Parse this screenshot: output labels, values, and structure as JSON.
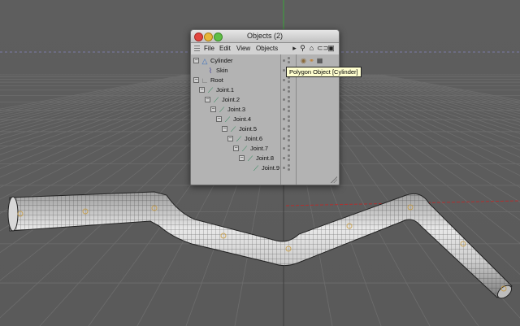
{
  "window": {
    "title": "Objects (2)"
  },
  "menu": {
    "file": "File",
    "edit": "Edit",
    "view": "View",
    "objects": "Objects"
  },
  "toolbar_icons": [
    "play-arrow-icon",
    "search-icon",
    "home-icon",
    "link-icon",
    "new-window-icon"
  ],
  "tree": [
    {
      "label": "Cylinder",
      "icon": "cylinder-icon",
      "depth": 0,
      "expander": "minus"
    },
    {
      "label": "Skin",
      "icon": "skin-icon",
      "depth": 1,
      "expander": "none"
    },
    {
      "label": "Root",
      "icon": "null-icon",
      "depth": 0,
      "expander": "minus"
    },
    {
      "label": "Joint.1",
      "icon": "joint-icon",
      "depth": 1,
      "expander": "minus"
    },
    {
      "label": "Joint.2",
      "icon": "joint-icon",
      "depth": 2,
      "expander": "minus"
    },
    {
      "label": "Joint.3",
      "icon": "joint-icon",
      "depth": 3,
      "expander": "minus"
    },
    {
      "label": "Joint.4",
      "icon": "joint-icon",
      "depth": 4,
      "expander": "minus"
    },
    {
      "label": "Joint.5",
      "icon": "joint-icon",
      "depth": 5,
      "expander": "minus"
    },
    {
      "label": "Joint.6",
      "icon": "joint-icon",
      "depth": 6,
      "expander": "minus"
    },
    {
      "label": "Joint.7",
      "icon": "joint-icon",
      "depth": 7,
      "expander": "minus"
    },
    {
      "label": "Joint.8",
      "icon": "joint-icon",
      "depth": 8,
      "expander": "minus"
    },
    {
      "label": "Joint.9",
      "icon": "joint-icon",
      "depth": 9,
      "expander": "none"
    }
  ],
  "cylinder_tags": [
    "phong-tag-icon",
    "weight-tag-icon",
    "checker-tag-icon"
  ],
  "tooltip": "Polygon Object [Cylinder]",
  "colors": {
    "viewport_bg": "#5c5c5c",
    "grid": "#6b6b6b",
    "mesh_wire": "#2b2b2b",
    "mesh_fill": "#c8c8c8",
    "axis_red": "#b03030",
    "axis_green": "#3aa53a"
  }
}
